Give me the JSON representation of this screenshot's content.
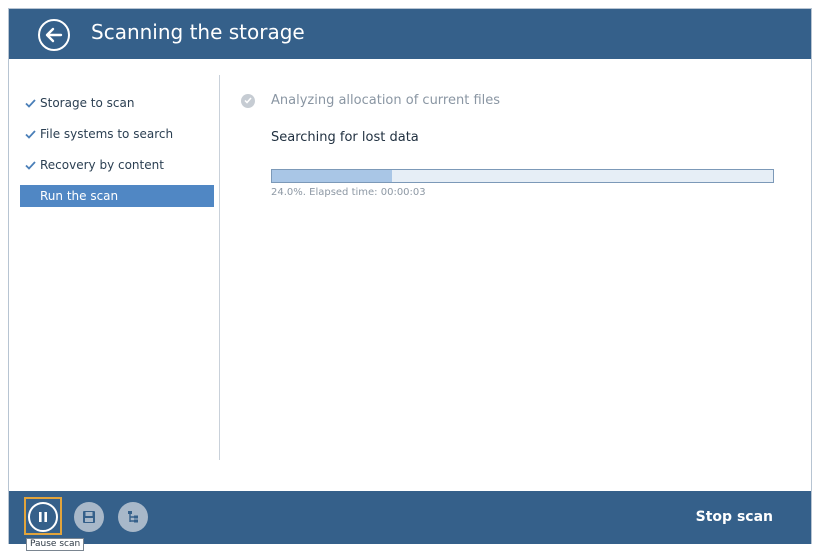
{
  "header": {
    "title": "Scanning the storage"
  },
  "sidebar": {
    "steps": [
      {
        "label": "Storage to scan",
        "done": true
      },
      {
        "label": "File systems to search",
        "done": true
      },
      {
        "label": "Recovery by content",
        "done": true
      },
      {
        "label": "Run the scan",
        "done": false,
        "active": true
      }
    ]
  },
  "main": {
    "completed_stage": "Analyzing allocation of current files",
    "current_stage": "Searching for lost data",
    "progress_percent": 24.0,
    "progress_text": "24.0%. Elapsed time: 00:00:03"
  },
  "footer": {
    "stop_label": "Stop scan"
  },
  "tooltip": {
    "text": "Pause scan"
  },
  "colors": {
    "header_bg": "#35608a",
    "active_step_bg": "#5087c4",
    "progress_fill": "#a9c6e6",
    "highlight": "#e2a43b"
  },
  "icons": [
    "back-arrow-icon",
    "checkmark-icon",
    "pause-icon",
    "save-icon",
    "tree-icon"
  ]
}
